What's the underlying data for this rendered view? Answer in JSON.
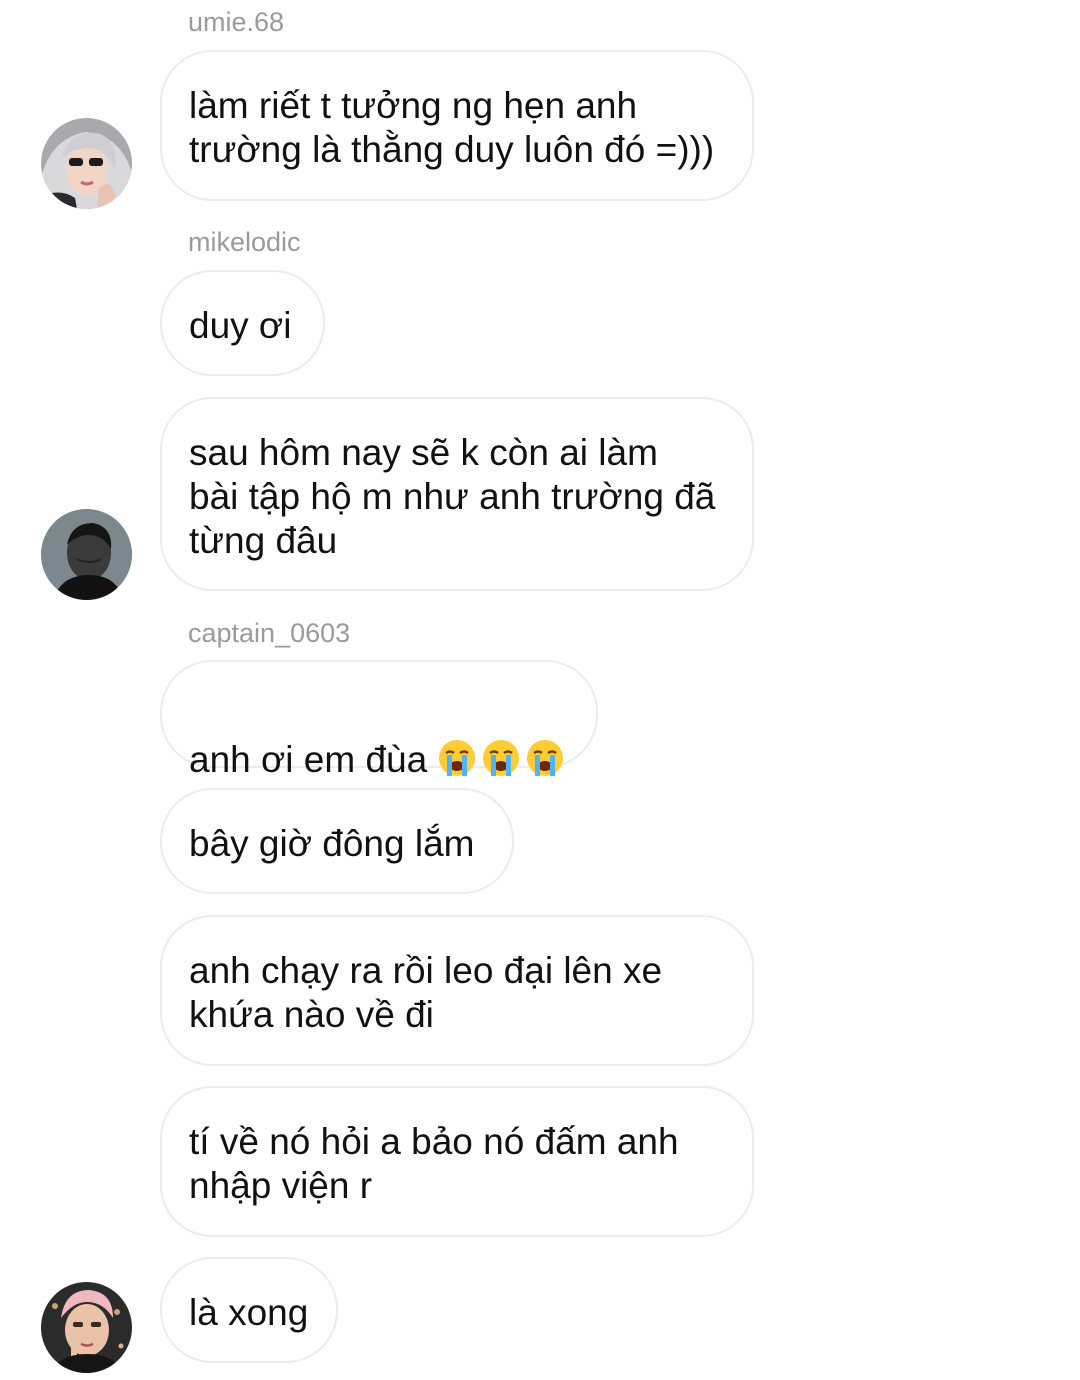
{
  "conversation": {
    "senders": {
      "umie": "umie.68",
      "mikelodic": "mikelodic",
      "captain": "captain_0603"
    },
    "messages": [
      "làm riết t tưởng ng hẹn anh\ntrường là thằng duy luôn đó =)))",
      "duy ơi",
      "sau hôm nay sẽ k còn ai làm\nbài tập hộ m như anh trường đã\ntừng đâu",
      "anh ơi em đùa",
      "bây giờ đông lắm",
      "anh chạy ra rồi leo đại lên xe\nkhứa nào về đi",
      "tí về nó hỏi a bảo nó đấm anh\nnhập viện r",
      "là xong"
    ],
    "emoji": [
      "loudly-crying-face",
      "loudly-crying-face",
      "loudly-crying-face"
    ],
    "colors": {
      "bubble_border": "#ececec",
      "sender_name": "#9a9a9a",
      "text": "#111111",
      "emoji_face": "#ffcc33",
      "emoji_tears": "#4fb3ff"
    }
  }
}
